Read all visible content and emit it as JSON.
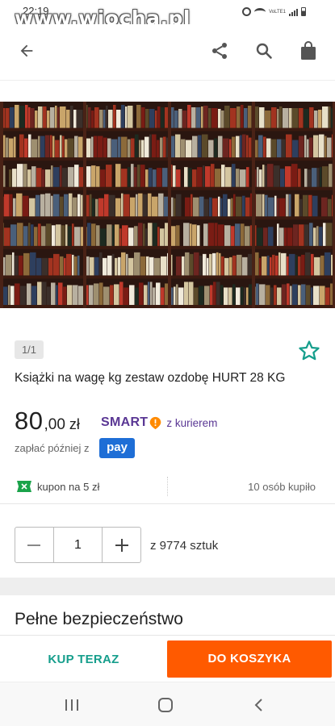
{
  "status_bar": {
    "time": "22:19",
    "volte": "VoLTE1"
  },
  "watermark": "www.wiocha.pl",
  "app_bar": {
    "back": "arrow-left-icon",
    "share": "share-icon",
    "search": "search-icon",
    "cart": "shopping-bag-icon"
  },
  "gallery": {
    "counter": "1/1"
  },
  "product": {
    "title": "Książki na wagę kg zestaw ozdobę HURT 28 KG",
    "price_main": "80",
    "price_decimal": ",00",
    "currency": "zł",
    "smart_label": "SMART",
    "smart_courier": "z kurierem",
    "pay_later": "zapłać później z",
    "pay_logo": "pay"
  },
  "coupon": {
    "text": "kupon na 5 zł",
    "bought": "10 osób kupiło"
  },
  "quantity": {
    "value": "1",
    "stock": "z 9774 sztuk"
  },
  "section": {
    "title": "Pełne bezpieczeństwo"
  },
  "actions": {
    "buy_now": "KUP TERAZ",
    "add_to_cart": "DO KOSZYKA"
  },
  "colors": {
    "accent_orange": "#ff5a00",
    "teal": "#169e8c",
    "smart_purple": "#5a3794",
    "pay_blue": "#1e6ed6"
  }
}
